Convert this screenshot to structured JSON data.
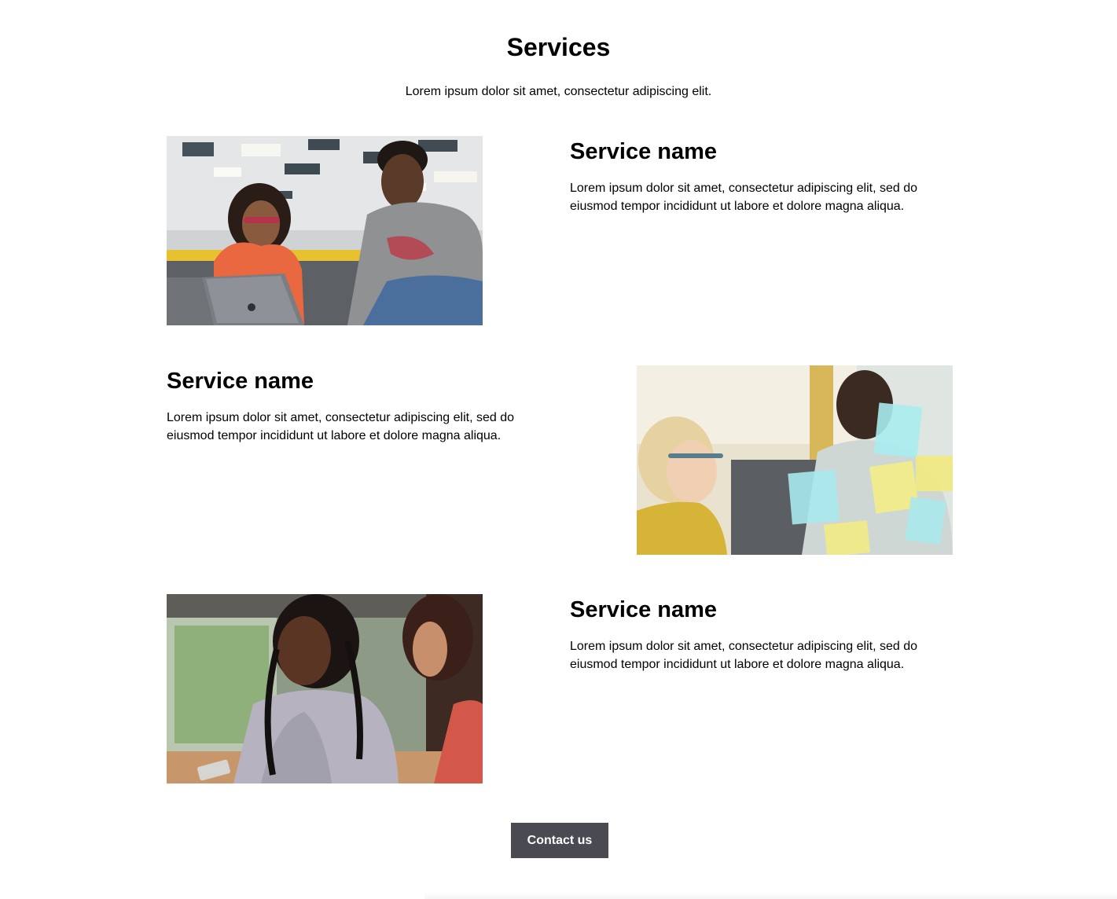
{
  "header": {
    "title": "Services",
    "intro": "Lorem ipsum dolor sit amet, consectetur adipiscing elit."
  },
  "services": [
    {
      "name": "Service name",
      "description": "Lorem ipsum dolor sit amet, consectetur adipiscing elit, sed do eiusmod tempor incididunt ut labore et dolore magna aliqua.",
      "image": "photo-two-colleagues-laptop"
    },
    {
      "name": "Service name",
      "description": "Lorem ipsum dolor sit amet, consectetur adipiscing elit, sed do eiusmod tempor incididunt ut labore et dolore magna aliqua.",
      "image": "photo-sticky-notes-glass-wall"
    },
    {
      "name": "Service name",
      "description": "Lorem ipsum dolor sit amet, consectetur adipiscing elit, sed do eiusmod tempor incididunt ut labore et dolore magna aliqua.",
      "image": "photo-women-discussing-phone"
    }
  ],
  "cta": {
    "label": "Contact us",
    "background": "#4a4a52",
    "color": "#ffffff"
  }
}
